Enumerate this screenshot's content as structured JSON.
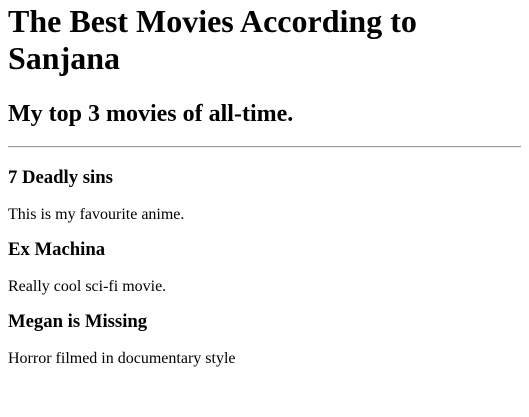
{
  "page": {
    "title": "The Best Movies According to Sanjana",
    "subtitle": "My top 3 movies of all-time."
  },
  "movies": [
    {
      "title": "7 Deadly sins",
      "description": "This is my favourite anime."
    },
    {
      "title": "Ex Machina",
      "description": "Really cool sci-fi movie."
    },
    {
      "title": "Megan is Missing",
      "description": "Horror filmed in documentary style"
    }
  ]
}
